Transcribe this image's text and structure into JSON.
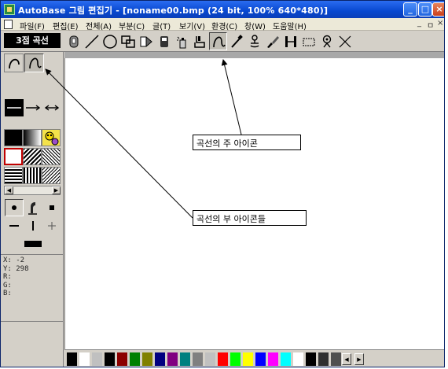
{
  "window": {
    "title": "AutoBase 그림 편집기 - [noname00.bmp (24 bit, 100% 640*480)]",
    "buttons": {
      "minimize": "_",
      "maximize": "□",
      "close": "×"
    }
  },
  "menu": {
    "items": [
      "파일(F)",
      "편집(E)",
      "전체(A)",
      "부분(C)",
      "글(T)",
      "보기(V)",
      "환경(C)",
      "창(W)",
      "도움말(H)"
    ],
    "mdi_controls": [
      "_",
      "ㅁ",
      "×"
    ]
  },
  "toolbar": {
    "mode_label": "3점 곡선",
    "tools": [
      "select-icon",
      "line-icon",
      "circle-icon",
      "rect-icon",
      "arrow-icon",
      "eraser-icon",
      "spray-icon",
      "fill-icon",
      "curve-icon",
      "dropper-icon",
      "stamp-icon",
      "brush-icon",
      "measure-icon",
      "rect-select-icon",
      "lasso-icon",
      "close-icon"
    ]
  },
  "left_panel": {
    "sub_tools": [
      "curve-sub-1-icon",
      "curve-sub-2-icon"
    ],
    "line_styles": [
      "plain-line-icon",
      "arrow-line-icon",
      "double-arrow-line-icon"
    ],
    "brushes": [
      "dot-brush-icon",
      "pen-brush-icon",
      "square-brush-icon",
      "horizontal-brush-icon",
      "vertical-brush-icon",
      "cross-brush-icon",
      "thick-line-brush-icon"
    ]
  },
  "coords": {
    "x_label": "X:",
    "x_value": "-2",
    "y_label": "Y:",
    "y_value": "298",
    "r_label": "R:",
    "g_label": "G:",
    "b_label": "B:"
  },
  "palette": {
    "colors": [
      "#000000",
      "#ffffff",
      "#c0c0c0",
      "#000000",
      "#8b0000",
      "#008000",
      "#808000",
      "#000080",
      "#800080",
      "#008080",
      "#808080",
      "#c0c0c0",
      "#ff0000",
      "#00ff00",
      "#ffff00",
      "#0000ff",
      "#ff00ff",
      "#00ffff",
      "#ffffff",
      "#000000",
      "#303030",
      "#505050"
    ]
  },
  "annotations": {
    "main_icon": "곡선의 주 아이콘",
    "sub_icons": "곡선의 부 아이콘들"
  }
}
